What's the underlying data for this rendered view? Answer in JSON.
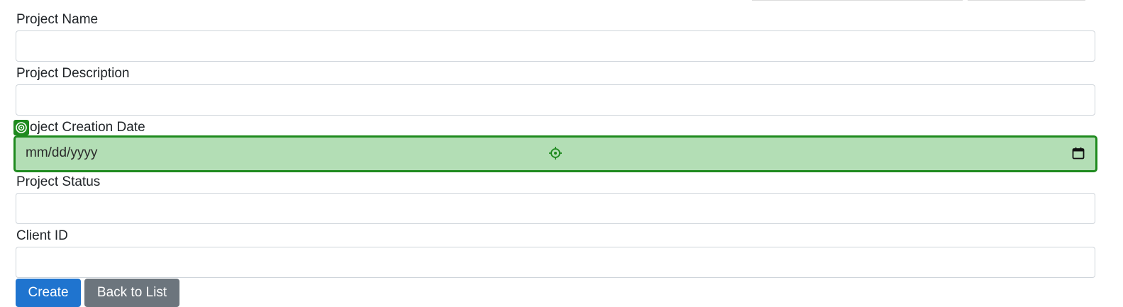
{
  "form": {
    "fields": [
      {
        "label": "Project Name",
        "value": ""
      },
      {
        "label": "Project Description",
        "value": ""
      },
      {
        "label": "oject Creation Date",
        "placeholder": "mm/dd/yyyy"
      },
      {
        "label": "Project Status",
        "value": ""
      },
      {
        "label": "Client ID",
        "value": ""
      }
    ]
  },
  "buttons": {
    "create": "Create",
    "back": "Back to List"
  },
  "colors": {
    "focus_fill": "#b3deb5",
    "focus_border": "#1e8a1e",
    "primary": "#1f74cf",
    "secondary": "#6c757d"
  },
  "icons": [
    "target-icon",
    "crosshair-icon",
    "calendar-icon"
  ]
}
